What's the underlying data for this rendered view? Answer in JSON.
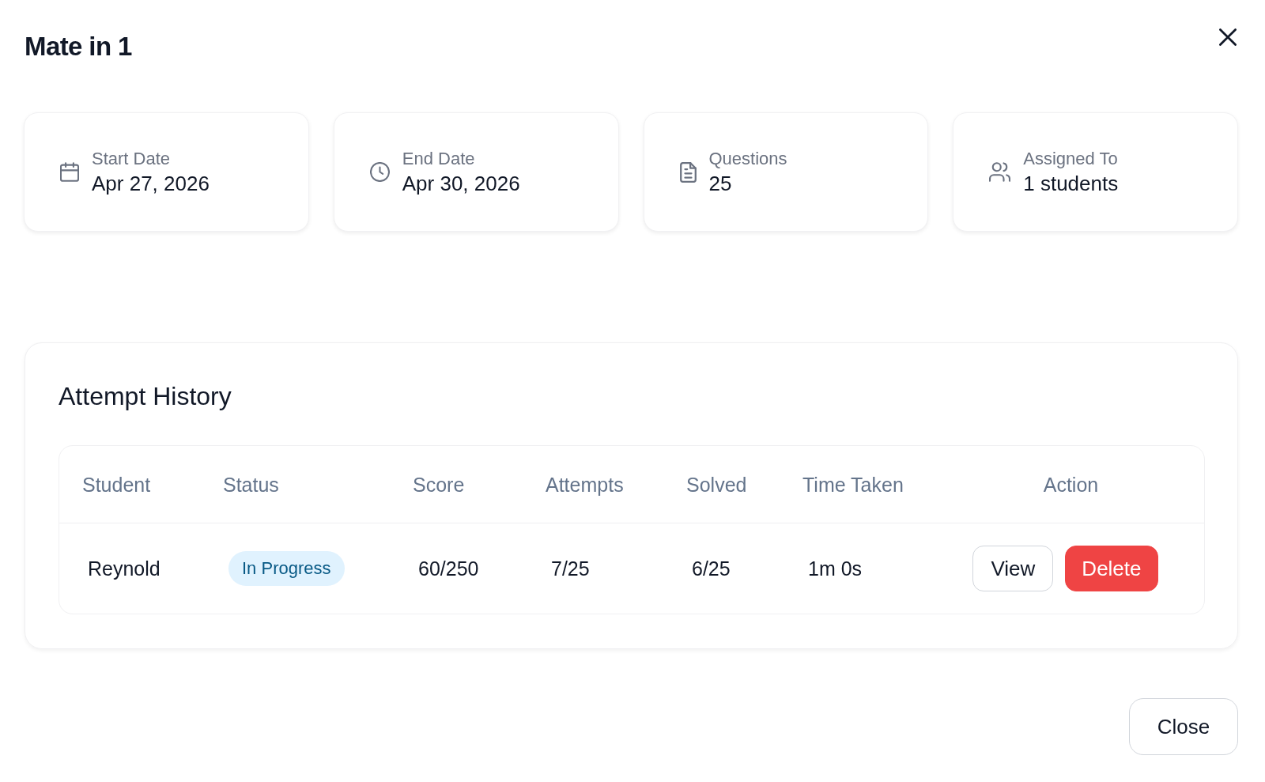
{
  "dialog": {
    "title": "Mate in 1"
  },
  "summary_cards": [
    {
      "label": "Start Date",
      "value": "Apr 27, 2026"
    },
    {
      "label": "End Date",
      "value": "Apr 30, 2026"
    },
    {
      "label": "Questions",
      "value": "25"
    },
    {
      "label": "Assigned To",
      "value": "1 students"
    }
  ],
  "attempt_history": {
    "title": "Attempt History",
    "table": {
      "columns": [
        "Student",
        "Status",
        "Score",
        "Attempts",
        "Solved",
        "Time Taken",
        "Action"
      ],
      "rows": [
        {
          "student": "Reynold",
          "status": "In Progress",
          "score": "60/250",
          "attempts": "7/25",
          "solved": "6/25",
          "time_taken": "1m 0s",
          "actions": [
            {
              "label": "View",
              "kind": "outline"
            },
            {
              "label": "Delete",
              "kind": "danger"
            }
          ]
        }
      ]
    }
  },
  "footer": {
    "buttons": [
      "Close"
    ]
  }
}
